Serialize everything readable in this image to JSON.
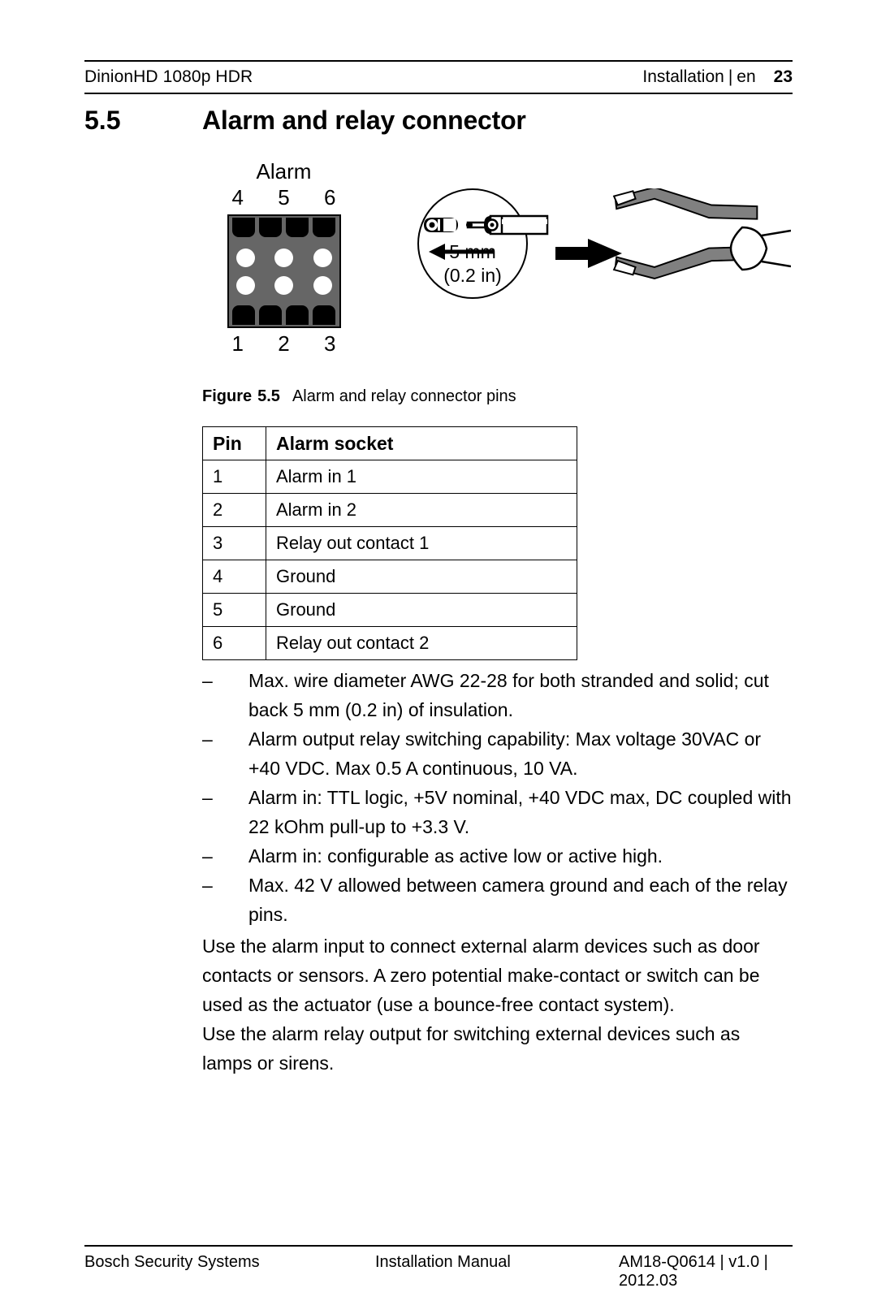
{
  "header": {
    "product": "DinionHD 1080p HDR",
    "section": "Installation",
    "pipe": "|",
    "language": "en",
    "page_number": "23"
  },
  "section": {
    "number": "5.5",
    "title": "Alarm and relay connector"
  },
  "figure": {
    "connector": {
      "title": "Alarm",
      "top_pins": [
        "4",
        "5",
        "6"
      ],
      "bottom_pins": [
        "1",
        "2",
        "3"
      ],
      "body_color": "#666666",
      "tab_color": "#000000",
      "hole_color": "#ffffff"
    },
    "strip_diagram": {
      "length_mm": "5 mm",
      "length_in": "(0.2 in)"
    },
    "caption_label": "Figure",
    "caption_number": "5.5",
    "caption_text": "Alarm and relay connector pins"
  },
  "table": {
    "headers": [
      "Pin",
      "Alarm socket"
    ],
    "rows": [
      [
        "1",
        "Alarm in 1"
      ],
      [
        "2",
        "Alarm in 2"
      ],
      [
        "3",
        "Relay out contact 1"
      ],
      [
        "4",
        "Ground"
      ],
      [
        "5",
        "Ground"
      ],
      [
        "6",
        "Relay out contact 2"
      ]
    ]
  },
  "bullets": {
    "dash": "–",
    "items": [
      "Max. wire diameter AWG 22-28 for both stranded and solid; cut back 5 mm (0.2 in) of insulation.",
      "Alarm output relay switching capability: Max voltage 30VAC or +40 VDC. Max 0.5 A continuous, 10 VA.",
      "Alarm in: TTL logic, +5V nominal, +40 VDC max, DC coupled with 22 kOhm pull-up to +3.3 V.",
      "Alarm in: configurable as active low or active high.",
      "Max. 42 V allowed between camera ground and each of the relay pins."
    ]
  },
  "paragraphs": [
    "Use the alarm input to connect external alarm devices such as door contacts or sensors. A zero potential make-contact or switch can be used as the actuator (use a bounce-free contact system).",
    "Use the alarm relay output for switching external devices such as lamps or sirens."
  ],
  "footer": {
    "left": "Bosch Security Systems",
    "middle": "Installation Manual",
    "right": "AM18-Q0614 | v1.0 | 2012.03"
  }
}
